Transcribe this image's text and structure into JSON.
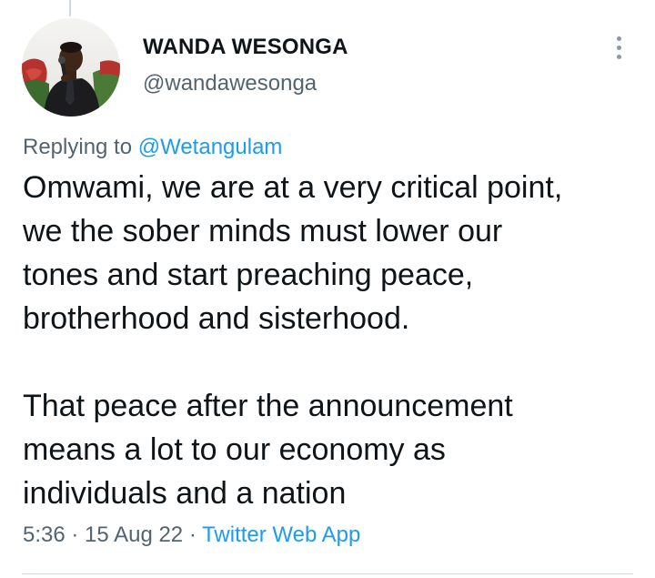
{
  "author": {
    "display_name": "WANDA WESONGA",
    "handle": "@wandawesonga",
    "avatar_icon": "profile-photo-speaker-with-microphone"
  },
  "reply_context": {
    "prefix": "Replying to ",
    "mention": "@Wetangulam"
  },
  "tweet": {
    "paragraphs": [
      "Omwami, we are at a very critical point,\nwe the sober minds must lower our\ntones and start preaching peace,\nbrotherhood and sisterhood.",
      "That peace after the announcement\nmeans a lot to our economy as\nindividuals and a nation"
    ]
  },
  "meta": {
    "time": "5:36",
    "separator": " · ",
    "date": "15 Aug 22",
    "source": "Twitter Web App"
  },
  "more_menu": {
    "icon": "more-vertical-icon"
  },
  "colors": {
    "text_primary": "#0f1419",
    "text_secondary": "#536471",
    "link": "#1d9bf0",
    "border": "#cfd9de"
  }
}
